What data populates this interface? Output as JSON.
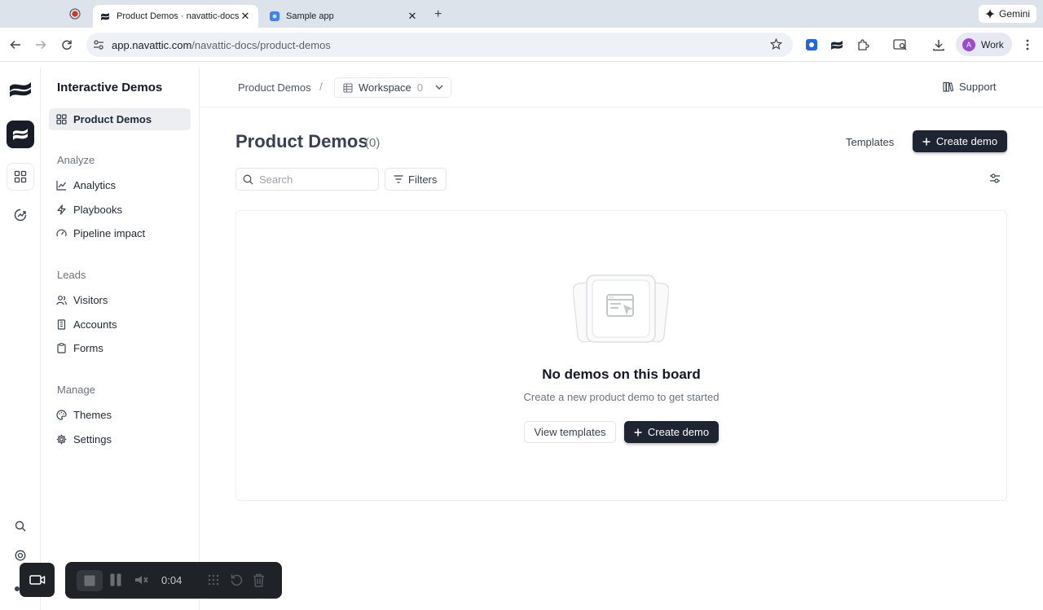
{
  "browser": {
    "tabs": [
      {
        "title": "Product Demos · navattic-docs",
        "active": true
      },
      {
        "title": "Sample app",
        "active": false
      }
    ],
    "gemini_label": "Gemini",
    "url_host": "app.navattic.com",
    "url_path": "/navattic-docs/product-demos",
    "profile_initial": "A",
    "profile_label": "Work"
  },
  "sidebar": {
    "title": "Interactive Demos",
    "active_item": "Product Demos",
    "sections": [
      {
        "label": "Analyze",
        "items": [
          "Analytics",
          "Playbooks",
          "Pipeline impact"
        ]
      },
      {
        "label": "Leads",
        "items": [
          "Visitors",
          "Accounts",
          "Forms"
        ]
      },
      {
        "label": "Manage",
        "items": [
          "Themes",
          "Settings"
        ]
      }
    ]
  },
  "header": {
    "breadcrumb": "Product Demos",
    "separator": "/",
    "workspace_label": "Workspace",
    "workspace_count": "0",
    "support_label": "Support"
  },
  "main": {
    "title": "Product Demos",
    "count": "(0)",
    "templates_label": "Templates",
    "create_label": "Create demo",
    "search_placeholder": "Search",
    "filters_label": "Filters",
    "empty_title": "No demos on this board",
    "empty_subtitle": "Create a new product demo to get started",
    "view_templates_label": "View templates",
    "empty_create_label": "Create demo"
  },
  "recorder": {
    "elapsed": "0:04"
  },
  "colors": {
    "brand_dark": "#1f2433",
    "tabbar": "#dde3ea",
    "recorder_bg": "#1f2226",
    "avatar": "#9a4bd6"
  }
}
